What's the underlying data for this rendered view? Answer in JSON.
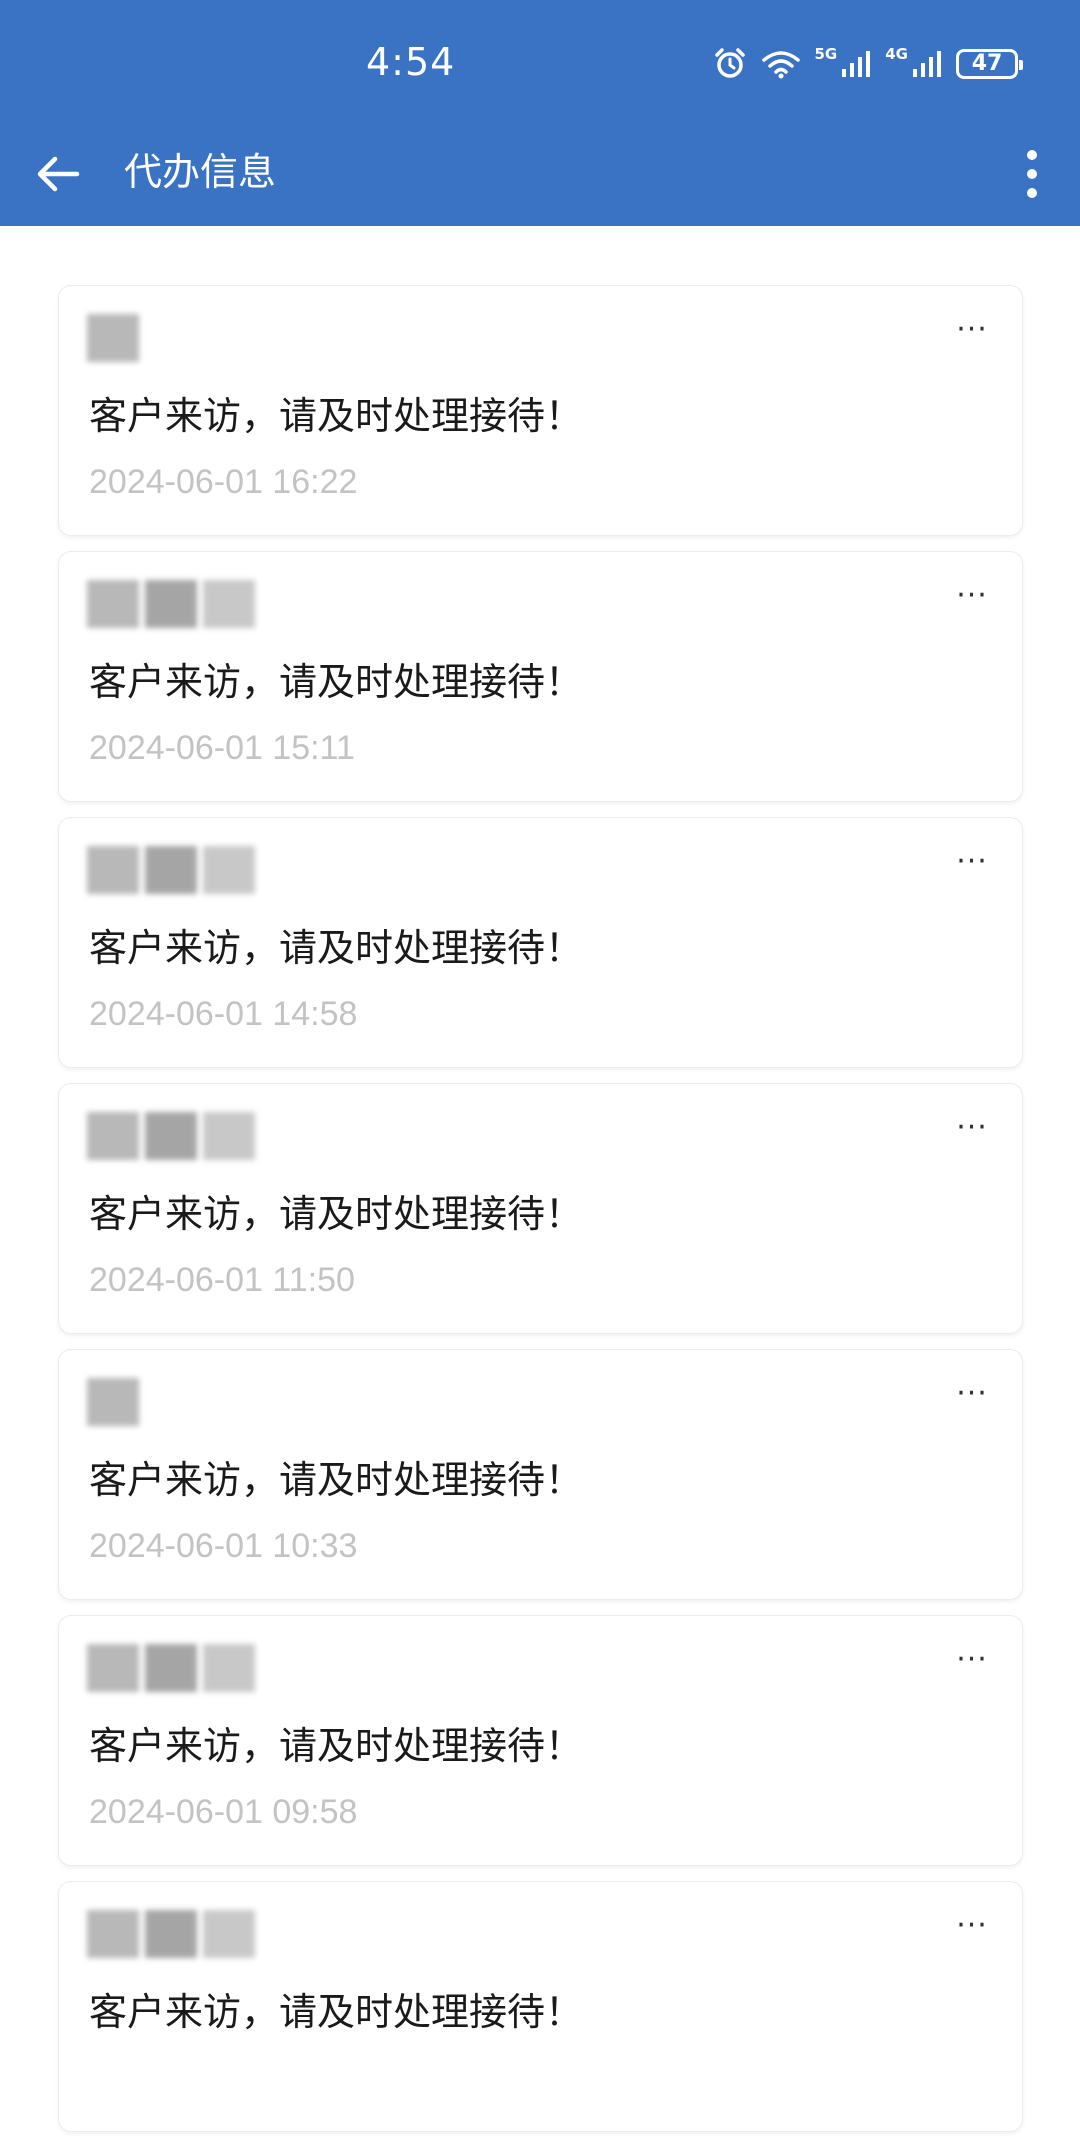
{
  "status_bar": {
    "time": "4:54",
    "network_1": "5G",
    "network_2": "4G",
    "battery": "47",
    "icons": [
      "alarm-icon",
      "wifi-icon",
      "signal-5g-icon",
      "signal-4g-icon",
      "battery-icon"
    ]
  },
  "app_bar": {
    "title": "代办信息",
    "back_icon": "arrow-left-icon",
    "more_icon": "more-vertical-icon"
  },
  "todo_list": {
    "menu_icon": "more-horizontal-icon",
    "menu_glyph": "···",
    "items": [
      {
        "sender_blocks": 1,
        "message": "客户来访，请及时处理接待！",
        "time": "2024-06-01 16:22"
      },
      {
        "sender_blocks": 3,
        "message": "客户来访，请及时处理接待！",
        "time": "2024-06-01 15:11"
      },
      {
        "sender_blocks": 3,
        "message": "客户来访，请及时处理接待！",
        "time": "2024-06-01 14:58"
      },
      {
        "sender_blocks": 3,
        "message": "客户来访，请及时处理接待！",
        "time": "2024-06-01 11:50"
      },
      {
        "sender_blocks": 1,
        "message": "客户来访，请及时处理接待！",
        "time": "2024-06-01 10:33"
      },
      {
        "sender_blocks": 3,
        "message": "客户来访，请及时处理接待！",
        "time": "2024-06-01 09:58"
      },
      {
        "sender_blocks": 3,
        "message": "客户来访，请及时处理接待！",
        "time": ""
      }
    ]
  },
  "colors": {
    "header_bg": "#3a73c3",
    "timestamp": "#c3c3c3",
    "message": "#1a1a1a"
  }
}
